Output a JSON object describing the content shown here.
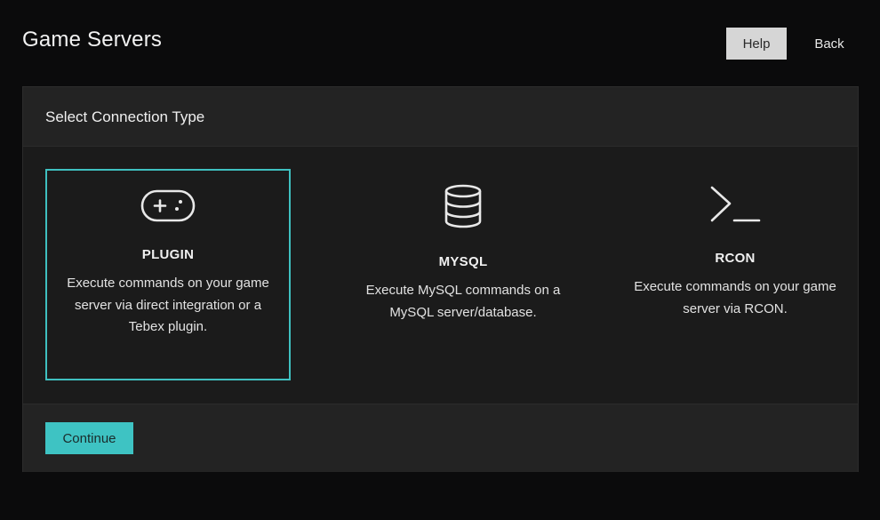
{
  "header": {
    "title": "Game Servers",
    "help_label": "Help",
    "back_label": "Back"
  },
  "panel": {
    "title": "Select Connection Type",
    "options": [
      {
        "icon": "gamepad-icon",
        "title": "PLUGIN",
        "description": "Execute commands on your game server via direct integration or a Tebex plugin.",
        "selected": true
      },
      {
        "icon": "database-icon",
        "title": "MYSQL",
        "description": "Execute MySQL commands on a MySQL server/database.",
        "selected": false
      },
      {
        "icon": "terminal-icon",
        "title": "RCON",
        "description": "Execute commands on your game server via RCON.",
        "selected": false
      }
    ],
    "continue_label": "Continue"
  },
  "colors": {
    "background": "#0b0b0c",
    "panel": "#1b1b1b",
    "panel_header": "#232323",
    "accent": "#3ec3c3",
    "help_button": "#d6d6d6"
  }
}
